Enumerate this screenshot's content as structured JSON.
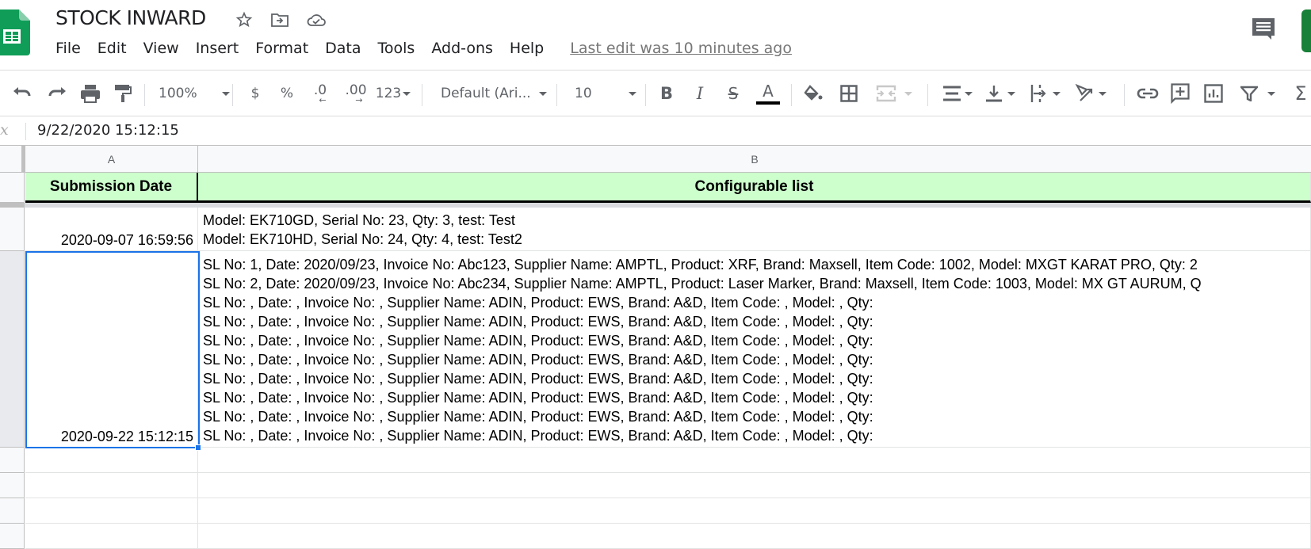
{
  "app": {
    "title": "STOCK INWARD",
    "last_edit": "Last edit was 10 minutes ago",
    "brand_color": "#0f9d58",
    "share_color": "#188038"
  },
  "menu": [
    "File",
    "Edit",
    "View",
    "Insert",
    "Format",
    "Data",
    "Tools",
    "Add-ons",
    "Help"
  ],
  "toolbar": {
    "zoom": "100%",
    "currency": "$",
    "percent": "%",
    "decrease_decimal": ".0",
    "increase_decimal": ".00",
    "more_formats": "123",
    "font": "Default (Ari...",
    "font_size": "10",
    "bold": "B",
    "italic": "I",
    "strikethrough": "S",
    "text_color": "A",
    "sum": "Σ"
  },
  "formula_bar": {
    "fx": "fx",
    "value": "9/22/2020 15:12:15"
  },
  "sheet": {
    "columns": [
      "A",
      "B"
    ],
    "header_row": [
      "Submission Date",
      "Configurable list"
    ],
    "header_fill": "#ccffcc",
    "rows": [
      {
        "date": "2020-09-07 16:59:56",
        "lines": [
          "Model: EK710GD, Serial No: 23, Qty: 3, test: Test",
          "Model: EK710HD, Serial No: 24, Qty: 4, test: Test2"
        ]
      },
      {
        "date": "2020-09-22 15:12:15",
        "lines": [
          "SL No: 1, Date: 2020/09/23, Invoice No: Abc123, Supplier Name: AMPTL, Product: XRF, Brand: Maxsell, Item Code: 1002, Model: MXGT KARAT PRO, Qty: 2",
          "SL No: 2, Date: 2020/09/23, Invoice No: Abc234, Supplier Name: AMPTL, Product: Laser Marker, Brand: Maxsell, Item Code: 1003, Model: MX GT AURUM, Q",
          "SL No: , Date: , Invoice No: , Supplier Name: ADIN, Product: EWS, Brand: A&D, Item Code: , Model: , Qty:",
          "SL No: , Date: , Invoice No: , Supplier Name: ADIN, Product: EWS, Brand: A&D, Item Code: , Model: , Qty:",
          "SL No: , Date: , Invoice No: , Supplier Name: ADIN, Product: EWS, Brand: A&D, Item Code: , Model: , Qty:",
          "SL No: , Date: , Invoice No: , Supplier Name: ADIN, Product: EWS, Brand: A&D, Item Code: , Model: , Qty:",
          "SL No: , Date: , Invoice No: , Supplier Name: ADIN, Product: EWS, Brand: A&D, Item Code: , Model: , Qty:",
          "SL No: , Date: , Invoice No: , Supplier Name: ADIN, Product: EWS, Brand: A&D, Item Code: , Model: , Qty:",
          "SL No: , Date: , Invoice No: , Supplier Name: ADIN, Product: EWS, Brand: A&D, Item Code: , Model: , Qty:",
          "SL No: , Date: , Invoice No: , Supplier Name: ADIN, Product: EWS, Brand: A&D, Item Code: , Model: , Qty:"
        ]
      }
    ],
    "selected_cell": "A3",
    "selection_color": "#1a73e8"
  }
}
